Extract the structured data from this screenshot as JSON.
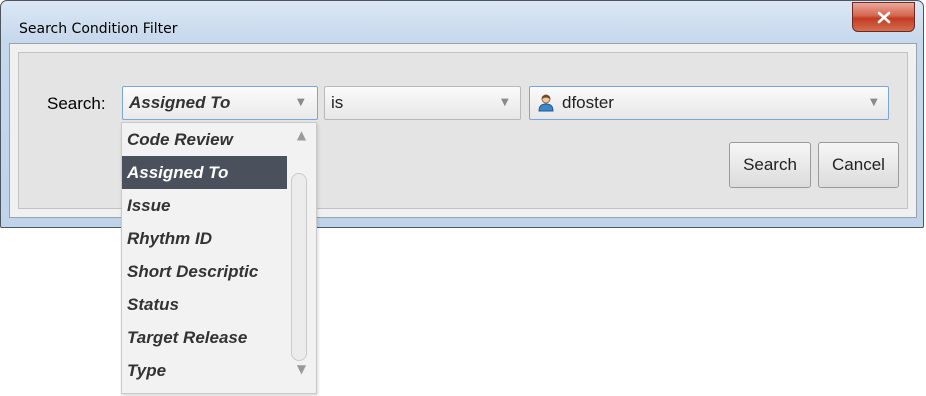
{
  "window": {
    "title": "Search Condition Filter",
    "close_icon": "close-icon"
  },
  "filter": {
    "search_label": "Search:",
    "field_value": "Assigned To",
    "operator_value": "is",
    "value_value": "dfoster",
    "value_icon": "user-icon"
  },
  "buttons": {
    "search_label": "Search",
    "cancel_label": "Cancel"
  },
  "dropdown": {
    "selected": "Assigned To",
    "items": [
      "Code Review",
      "Assigned To",
      "Issue",
      "Rhythm ID",
      "Short Descriptic",
      "Status",
      "Target Release",
      "Type"
    ]
  },
  "colors": {
    "selection": "#4a505c",
    "close_button": "#c23a22",
    "focus_border": "#7aa7d8"
  }
}
